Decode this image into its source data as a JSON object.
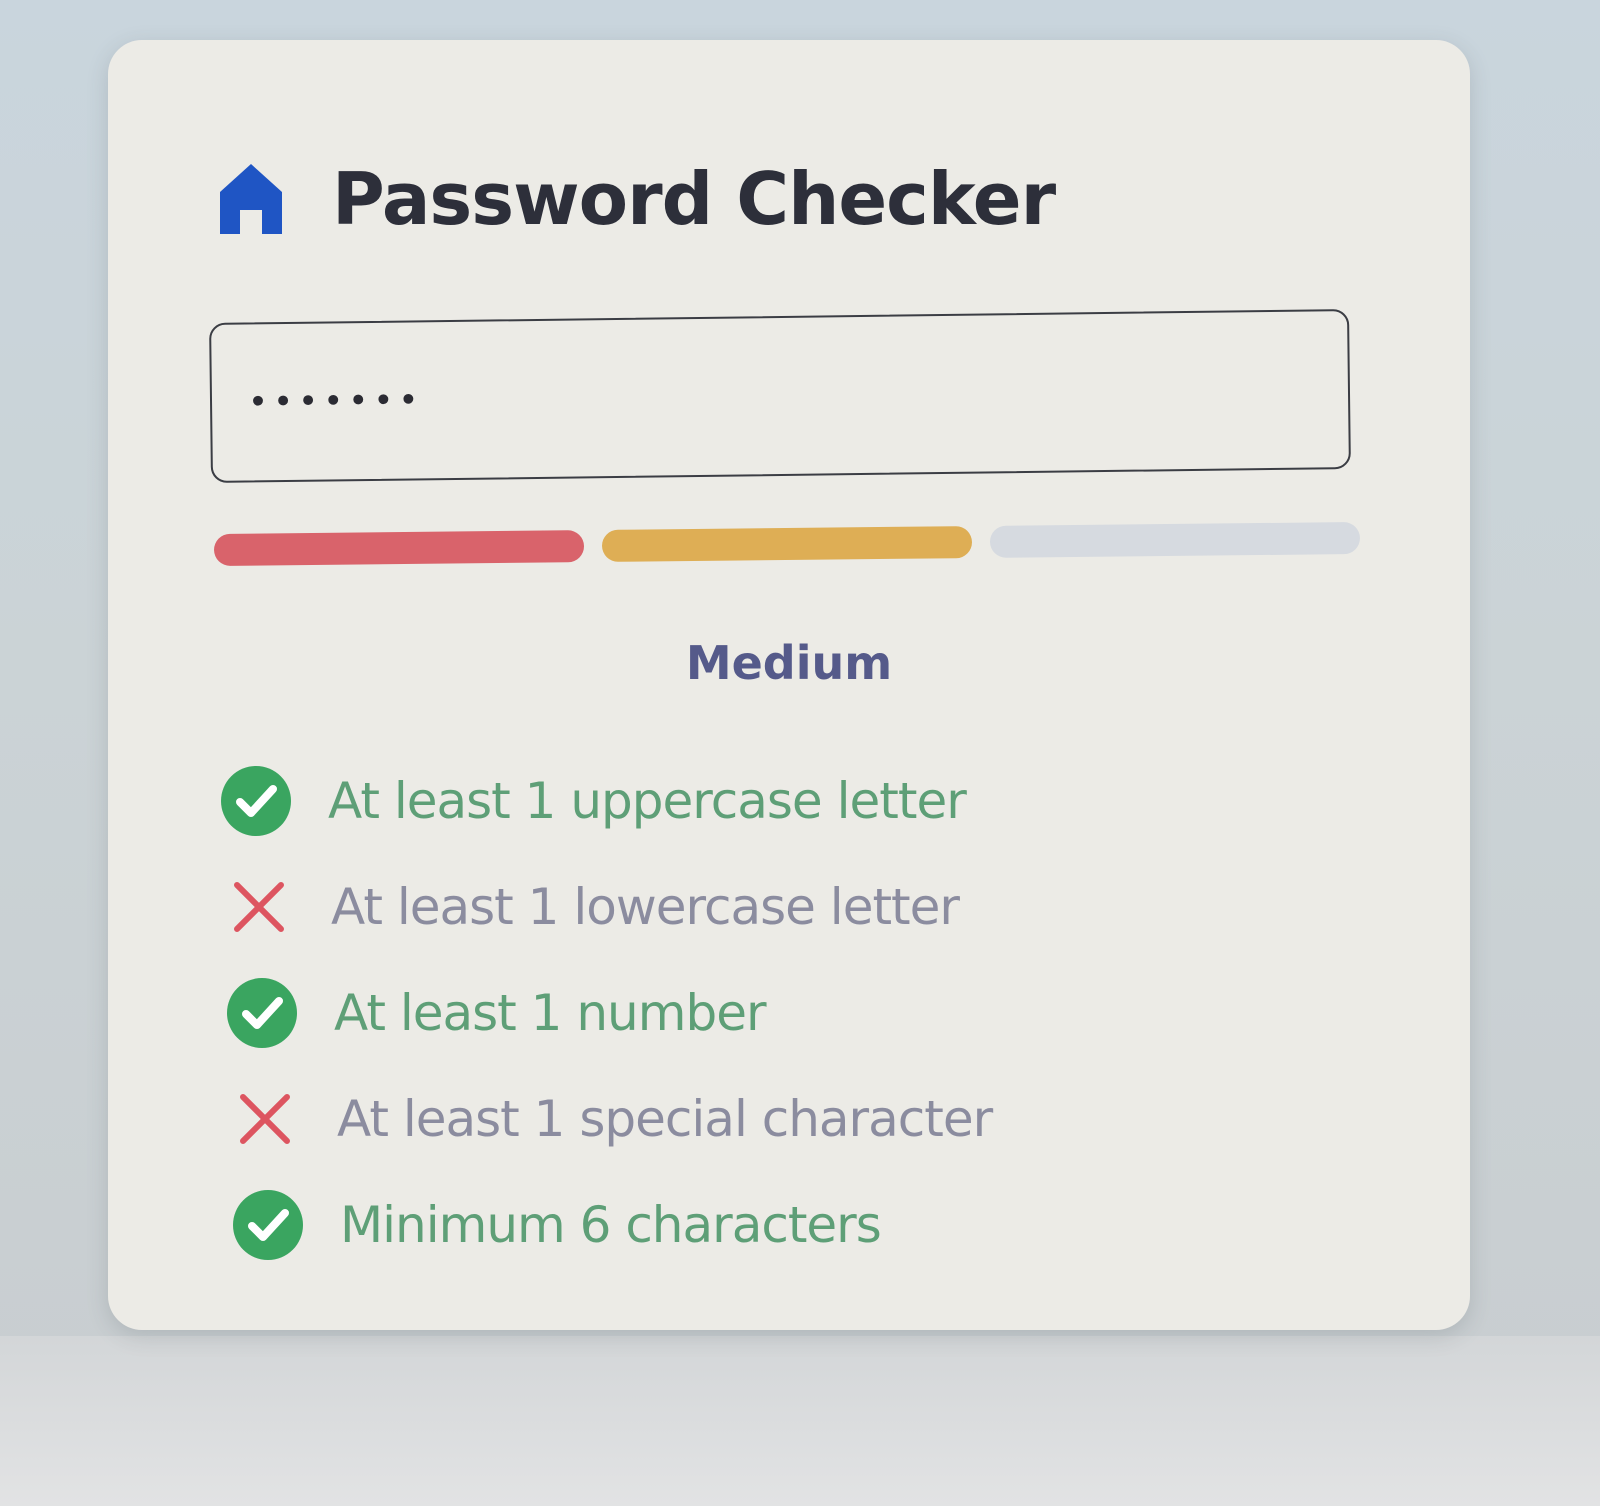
{
  "app": {
    "title": "Password Checker",
    "logo_icon": "house-icon"
  },
  "password_field": {
    "masked_value": "•••••••",
    "character_count": 7
  },
  "strength": {
    "label": "Medium",
    "label_color": "#555a8a",
    "segments_filled": 2,
    "segments_total": 3,
    "segment_colors": [
      "#d9636b",
      "#deae55",
      "#d6dae0"
    ]
  },
  "requirements": [
    {
      "label": "At least 1 uppercase letter",
      "met": true,
      "icon": "check-circle-icon"
    },
    {
      "label": "At least 1 lowercase letter",
      "met": false,
      "icon": "x-icon"
    },
    {
      "label": "At least 1 number",
      "met": true,
      "icon": "check-circle-icon"
    },
    {
      "label": "At least 1 special character",
      "met": false,
      "icon": "x-icon"
    },
    {
      "label": "Minimum 6 characters",
      "met": true,
      "icon": "check-circle-icon"
    }
  ],
  "colors": {
    "met_icon": "#3aa560",
    "met_text": "#5e9f77",
    "unmet_icon": "#dd5560",
    "unmet_text": "#8b8c9f",
    "title_text": "#2d2f3a",
    "logo": "#1f55c4",
    "card_background": "#ecebe6"
  }
}
